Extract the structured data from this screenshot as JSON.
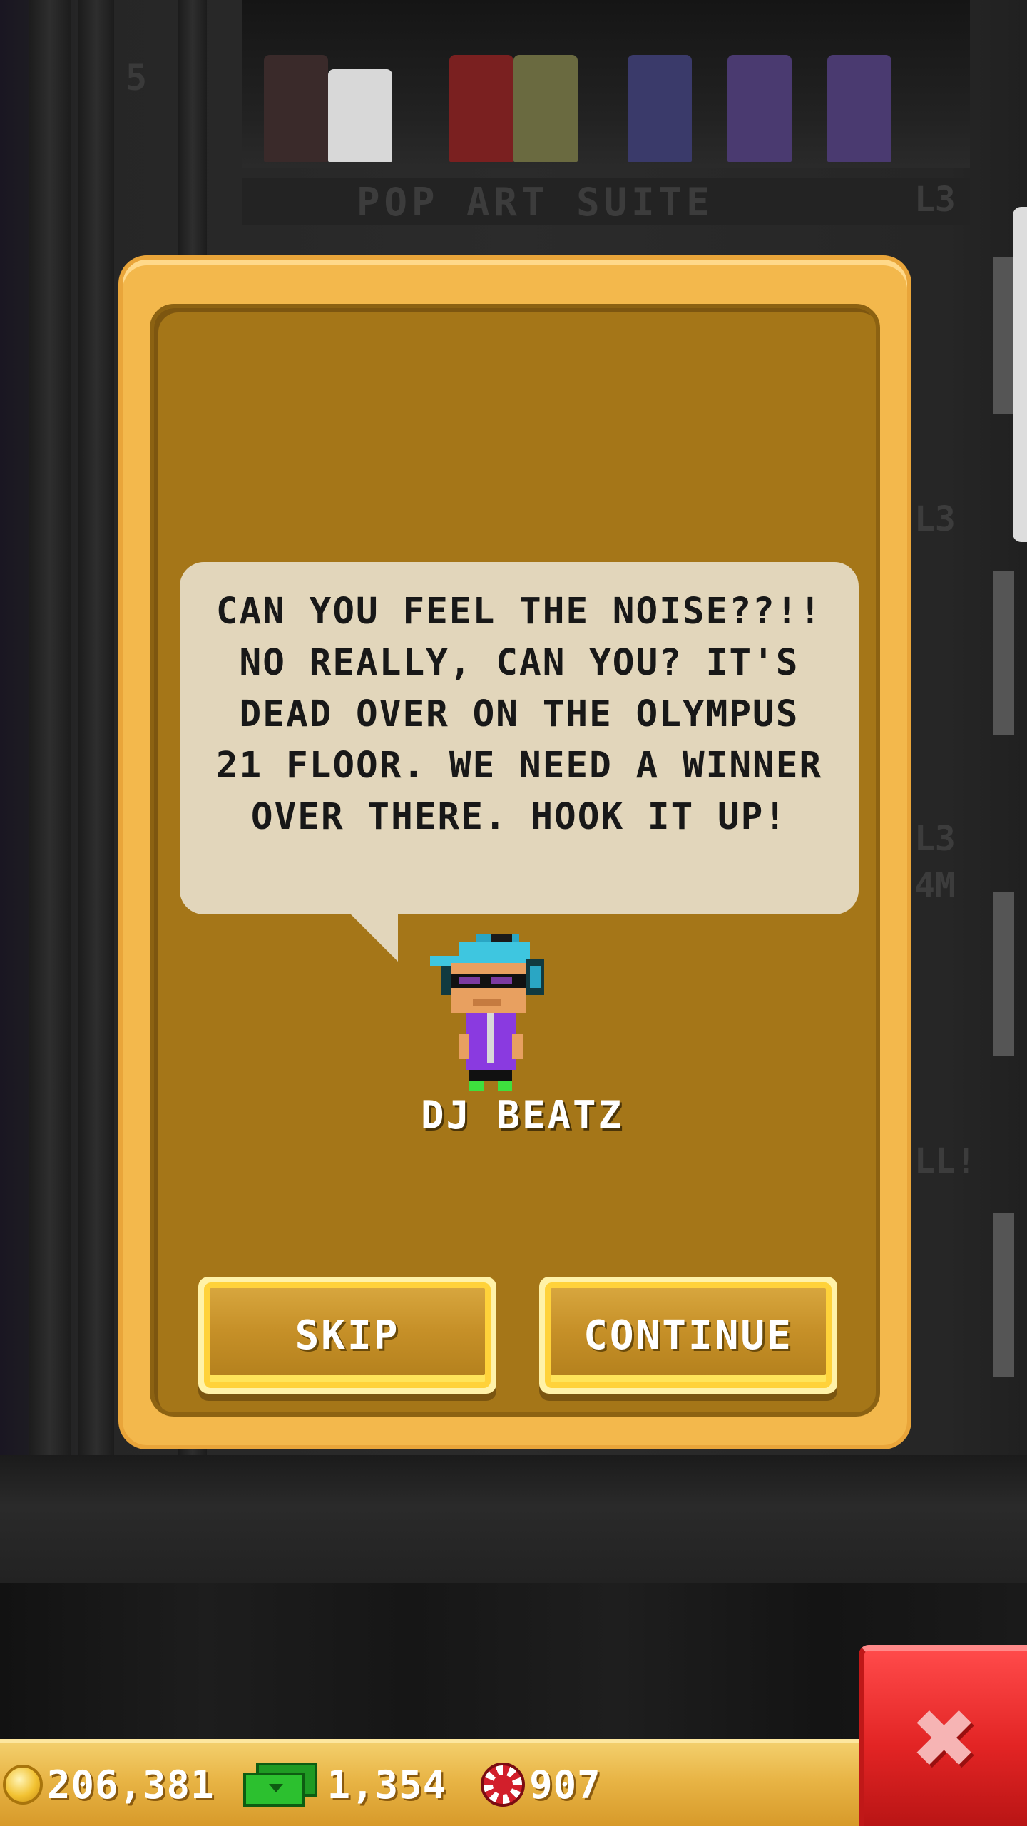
{
  "tower": {
    "floor_number": "5",
    "floor_name": "POP ART SUITE",
    "levels": [
      "L3",
      "L3",
      "L3",
      "4M",
      "LL!"
    ]
  },
  "dialog": {
    "message": "CAN YOU FEEL THE NOISE??!! NO REALLY, CAN YOU? IT'S DEAD OVER ON THE OLYMPUS 21 FLOOR. WE NEED A WINNER OVER THERE. HOOK IT UP!",
    "character_name": "DJ BEATZ",
    "skip_label": "SKIP",
    "continue_label": "CONTINUE"
  },
  "resources": {
    "coins": "206,381",
    "bux": "1,354",
    "chips": "907"
  },
  "icons": {
    "coin": "coin-icon",
    "bux": "tower-bux-icon",
    "chip": "casino-chip-icon",
    "close": "close-x-icon"
  },
  "colors": {
    "dialog_frame": "#f3b84c",
    "dialog_inner": "#a57618",
    "bubble": "#e2d6bb",
    "close_button": "#e22424"
  }
}
